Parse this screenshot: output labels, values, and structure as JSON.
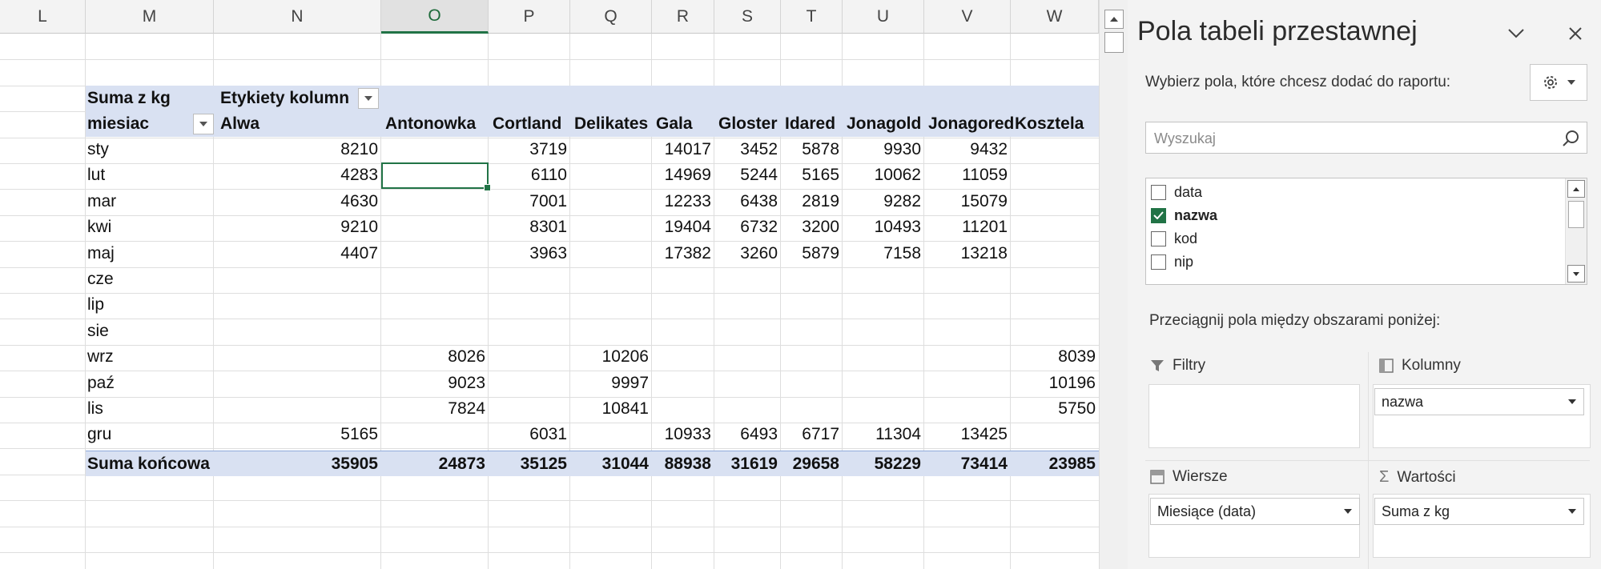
{
  "sheet": {
    "columns": [
      "L",
      "M",
      "N",
      "O",
      "P",
      "Q",
      "R",
      "S",
      "T",
      "U",
      "V",
      "W"
    ],
    "selected_column": "O",
    "header": {
      "values_label": "Suma z kg",
      "col_labels_label": "Etykiety kolumn",
      "row_label": "miesiac",
      "apples": [
        "Alwa",
        "Antonowka",
        "Cortland",
        "Delikates",
        "Gala",
        "Gloster",
        "Idared",
        "Jonagold",
        "Jonagored",
        "Kosztela"
      ]
    },
    "rows": [
      {
        "month": "sty",
        "values": [
          "8210",
          "",
          "3719",
          "",
          "14017",
          "3452",
          "5878",
          "9930",
          "9432",
          ""
        ]
      },
      {
        "month": "lut",
        "values": [
          "4283",
          "",
          "6110",
          "",
          "14969",
          "5244",
          "5165",
          "10062",
          "11059",
          ""
        ]
      },
      {
        "month": "mar",
        "values": [
          "4630",
          "",
          "7001",
          "",
          "12233",
          "6438",
          "2819",
          "9282",
          "15079",
          ""
        ]
      },
      {
        "month": "kwi",
        "values": [
          "9210",
          "",
          "8301",
          "",
          "19404",
          "6732",
          "3200",
          "10493",
          "11201",
          ""
        ]
      },
      {
        "month": "maj",
        "values": [
          "4407",
          "",
          "3963",
          "",
          "17382",
          "3260",
          "5879",
          "7158",
          "13218",
          ""
        ]
      },
      {
        "month": "cze",
        "values": [
          "",
          "",
          "",
          "",
          "",
          "",
          "",
          "",
          "",
          ""
        ]
      },
      {
        "month": "lip",
        "values": [
          "",
          "",
          "",
          "",
          "",
          "",
          "",
          "",
          "",
          ""
        ]
      },
      {
        "month": "sie",
        "values": [
          "",
          "",
          "",
          "",
          "",
          "",
          "",
          "",
          "",
          ""
        ]
      },
      {
        "month": "wrz",
        "values": [
          "",
          "8026",
          "",
          "10206",
          "",
          "",
          "",
          "",
          "",
          "8039"
        ]
      },
      {
        "month": "paź",
        "values": [
          "",
          "9023",
          "",
          "9997",
          "",
          "",
          "",
          "",
          "",
          "10196"
        ]
      },
      {
        "month": "lis",
        "values": [
          "",
          "7824",
          "",
          "10841",
          "",
          "",
          "",
          "",
          "",
          "5750"
        ]
      },
      {
        "month": "gru",
        "values": [
          "5165",
          "",
          "6031",
          "",
          "10933",
          "6493",
          "6717",
          "11304",
          "13425",
          ""
        ]
      }
    ],
    "total": {
      "label": "Suma końcowa",
      "values": [
        "35905",
        "24873",
        "35125",
        "31044",
        "88938",
        "31619",
        "29658",
        "58229",
        "73414",
        "23985"
      ]
    }
  },
  "pane": {
    "title": "Pola tabeli przestawnej",
    "choose_label": "Wybierz pola, które chcesz dodać do raportu:",
    "search_placeholder": "Wyszukaj",
    "fields": [
      {
        "name": "data",
        "checked": false
      },
      {
        "name": "nazwa",
        "checked": true
      },
      {
        "name": "kod",
        "checked": false
      },
      {
        "name": "nip",
        "checked": false
      }
    ],
    "drag_hint": "Przeciągnij pola między obszarami poniżej:",
    "areas": {
      "filters": {
        "label": "Filtry",
        "items": []
      },
      "columns": {
        "label": "Kolumny",
        "items": [
          "nazwa"
        ]
      },
      "rows": {
        "label": "Wiersze",
        "items": [
          "Miesiące (data)"
        ]
      },
      "values": {
        "label": "Wartości",
        "items": [
          "Suma z kg"
        ]
      }
    }
  },
  "colors": {
    "accent": "#217346",
    "pivot_band": "#d9e1f2"
  }
}
